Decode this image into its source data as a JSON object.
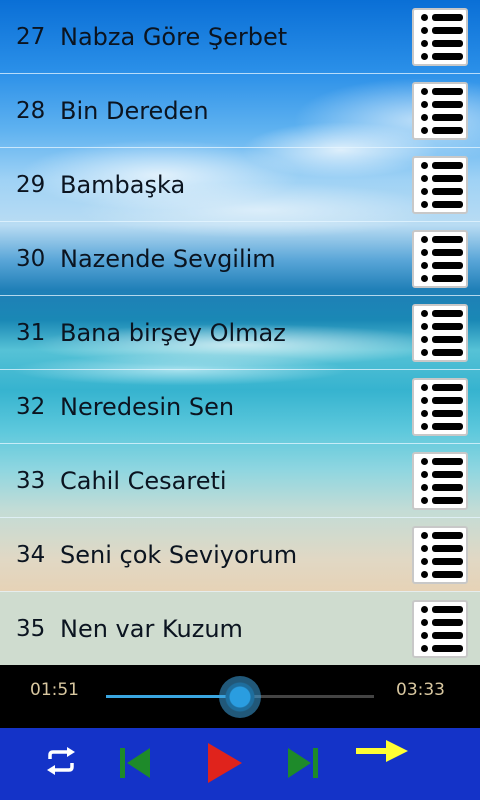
{
  "playlist": [
    {
      "num": "27",
      "title": "Nabza Göre Şerbet"
    },
    {
      "num": "28",
      "title": "Bin Dereden"
    },
    {
      "num": "29",
      "title": "Bambaşka"
    },
    {
      "num": "30",
      "title": "Nazende Sevgilim"
    },
    {
      "num": "31",
      "title": "Bana birşey Olmaz"
    },
    {
      "num": "32",
      "title": "Neredesin Sen"
    },
    {
      "num": "33",
      "title": "Cahil Cesareti"
    },
    {
      "num": "34",
      "title": "Seni çok Seviyorum"
    },
    {
      "num": "35",
      "title": "Nen var Kuzum"
    }
  ],
  "active_track": "35",
  "player": {
    "current_time": "01:51",
    "total_time": "03:33",
    "progress": 0.499
  },
  "controls": {
    "repeat_icon": "repeat-icon",
    "prev_icon": "skip-previous-icon",
    "play_icon": "play-icon",
    "next_icon": "skip-next-icon",
    "forward_icon": "arrow-right-icon"
  },
  "colors": {
    "control_bar": "#1433c8",
    "play": "#e0231c",
    "skip": "#1e8a2a",
    "arrow": "#ffff33",
    "time_text": "#d8c7a0",
    "seek_fill": "#3aa6e0"
  }
}
